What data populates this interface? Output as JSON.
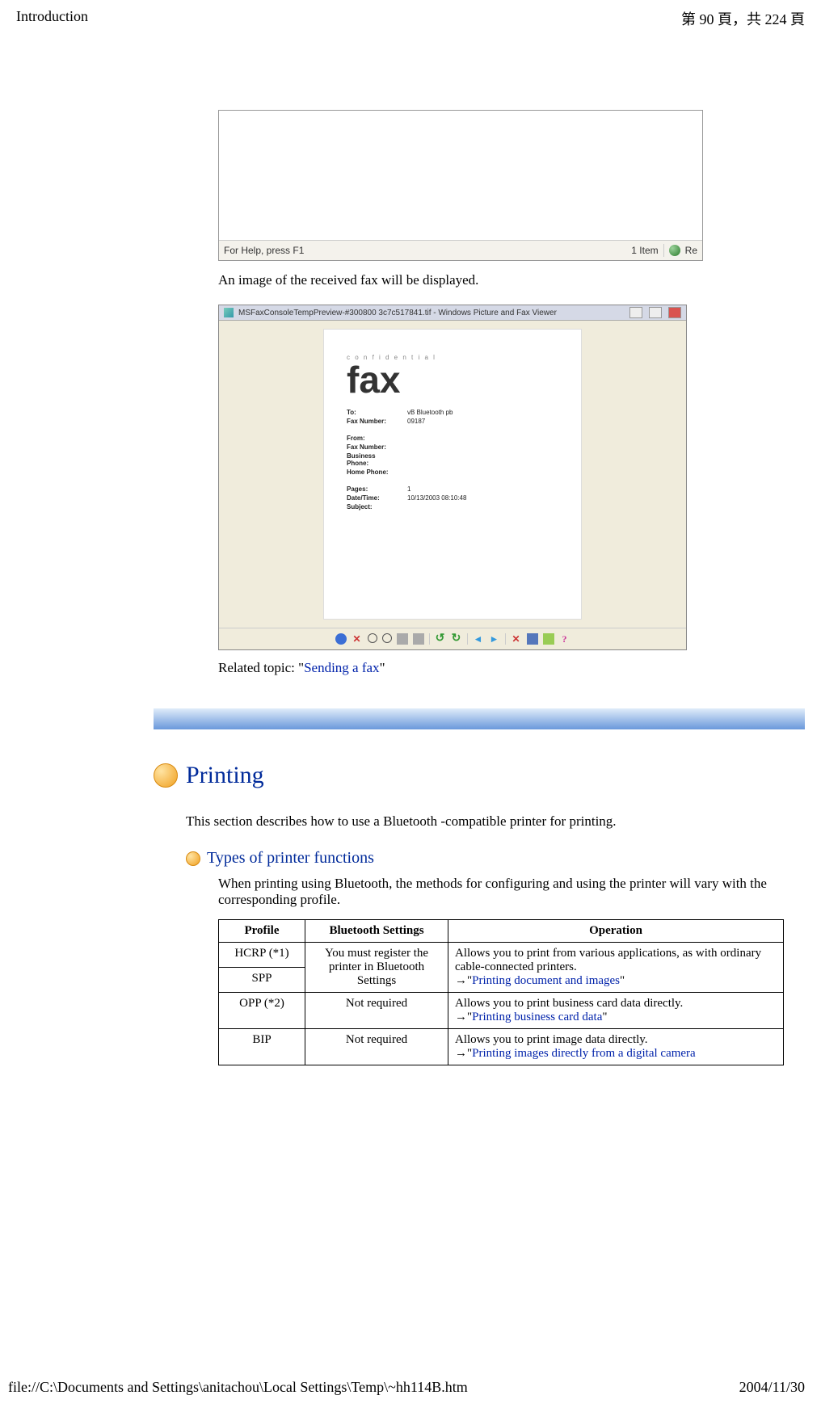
{
  "header": {
    "title": "Introduction",
    "page_info": "第 90 頁，共 224 頁"
  },
  "screenshot1": {
    "help_text": "For Help, press F1",
    "item_count": "1 Item",
    "re_label": "Re"
  },
  "caption": "An image of the received fax will be displayed.",
  "viewer": {
    "window_title": "MSFaxConsoleTempPreview-#300800 3c7c517841.tif - Windows Picture and Fax Viewer",
    "fax": {
      "confidential": "c o n f i d e n t i a l",
      "big": "fax",
      "rows1": [
        {
          "lbl": "To:",
          "val": "vB Bluetooth pb"
        },
        {
          "lbl": "Fax Number:",
          "val": "09187"
        }
      ],
      "rows2": [
        {
          "lbl": "From:",
          "val": ""
        },
        {
          "lbl": "Fax Number:",
          "val": ""
        },
        {
          "lbl": "Business Phone:",
          "val": ""
        },
        {
          "lbl": "Home Phone:",
          "val": ""
        }
      ],
      "rows3": [
        {
          "lbl": "Pages:",
          "val": "1"
        },
        {
          "lbl": "Date/Time:",
          "val": "10/13/2003 08:10:48"
        },
        {
          "lbl": "Subject:",
          "val": ""
        }
      ]
    }
  },
  "related": {
    "prefix": "Related topic: \"",
    "link": "Sending a fax",
    "suffix": "\""
  },
  "section": {
    "title": "Printing",
    "intro": "This section describes how to use a Bluetooth -compatible printer for printing.",
    "subsection": {
      "title": "Types of printer functions",
      "intro": "When printing using Bluetooth, the methods for configuring and using the printer will vary with the corresponding profile.",
      "table": {
        "headers": [
          "Profile",
          "Bluetooth Settings",
          "Operation"
        ],
        "row_hcrp_spp": {
          "profile1": "HCRP (*1)",
          "profile2": "SPP",
          "bt": "You must register the printer in Bluetooth Settings",
          "op_text": "Allows you to print from various applications, as with ordinary cable-connected printers.",
          "op_link": "Printing document and images"
        },
        "row_opp": {
          "profile": "OPP (*2)",
          "bt": "Not required",
          "op_text": "Allows you to print business card data directly.",
          "op_link": "Printing business card data"
        },
        "row_bip": {
          "profile": "BIP",
          "bt": "Not required",
          "op_text": "Allows you to print image data directly.",
          "op_link": "Printing images directly from a digital camera"
        }
      }
    }
  },
  "footer": {
    "path": "file://C:\\Documents and Settings\\anitachou\\Local Settings\\Temp\\~hh114B.htm",
    "date": "2004/11/30"
  }
}
